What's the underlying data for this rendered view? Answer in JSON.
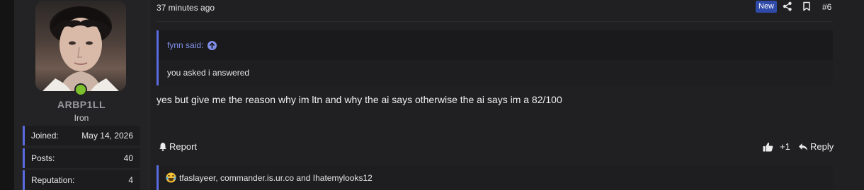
{
  "user": {
    "username": "ARBP1LL",
    "rank": "Iron",
    "stats": [
      {
        "label": "Joined:",
        "value": "May 14, 2026"
      },
      {
        "label": "Posts:",
        "value": "40"
      },
      {
        "label": "Reputation:",
        "value": "4"
      }
    ]
  },
  "post": {
    "timestamp": "37 minutes ago",
    "badge": "New",
    "number": "#6",
    "quote": {
      "author_line": "fynn said:",
      "text": "you asked i answered"
    },
    "message": "yes but give me the reason why im ltn and why the ai says otherwise the ai says im a 82/100",
    "actions": {
      "report": "Report",
      "like_count": "+1",
      "reply": "Reply"
    },
    "reactions_text": "tfaslayeer, commander.is.ur.co and Ihatemylooks12"
  },
  "colors": {
    "accent": "#5a6ae0",
    "online": "#7cc12b",
    "badge": "#2f4aa8"
  }
}
